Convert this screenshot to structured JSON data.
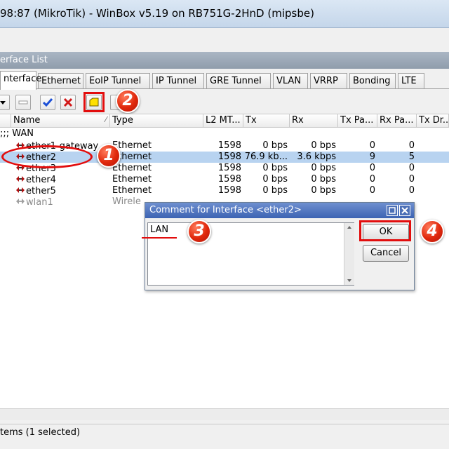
{
  "window": {
    "title": "98:87 (MikroTik) - WinBox v5.19 on RB751G-2HnD (mipsbe)"
  },
  "panel": {
    "header": "erface List"
  },
  "tabs": [
    {
      "label": "nterface",
      "active": true
    },
    {
      "label": "Ethernet"
    },
    {
      "label": "EoIP Tunnel"
    },
    {
      "label": "IP Tunnel"
    },
    {
      "label": "GRE Tunnel"
    },
    {
      "label": "VLAN"
    },
    {
      "label": "VRRP"
    },
    {
      "label": "Bonding"
    },
    {
      "label": "LTE"
    }
  ],
  "toolbar": {
    "buttons": [
      "dropdown-arrow",
      "disable",
      "enable",
      "remove",
      "comment",
      "filter"
    ],
    "colors": {
      "enable": "#1b4fd6",
      "remove": "#d21a1a",
      "comment": "#ffe000"
    }
  },
  "table": {
    "columns": [
      "Name",
      "Type",
      "L2 MT...",
      "Tx",
      "Rx",
      "Tx Pa...",
      "Rx Pa...",
      "Tx Dr..."
    ],
    "group": ";;; WAN",
    "rows": [
      {
        "name": "ether1-gateway",
        "type": "Ethernet",
        "mtu": "1598",
        "tx": "0 bps",
        "rx": "0 bps",
        "txp": "0",
        "rxp": "0"
      },
      {
        "name": "ether2",
        "type": "Ethernet",
        "mtu": "1598",
        "tx": "76.9 kb...",
        "rx": "3.6 kbps",
        "txp": "9",
        "rxp": "5",
        "selected": true
      },
      {
        "name": "ether3",
        "type": "Ethernet",
        "mtu": "1598",
        "tx": "0 bps",
        "rx": "0 bps",
        "txp": "0",
        "rxp": "0"
      },
      {
        "name": "ether4",
        "type": "Ethernet",
        "mtu": "1598",
        "tx": "0 bps",
        "rx": "0 bps",
        "txp": "0",
        "rxp": "0"
      },
      {
        "name": "ether5",
        "type": "Ethernet",
        "mtu": "1598",
        "tx": "0 bps",
        "rx": "0 bps",
        "txp": "0",
        "rxp": "0"
      },
      {
        "name": "wlan1",
        "type": "Wirele",
        "disabled": true
      }
    ]
  },
  "dialog": {
    "title": "Comment for Interface <ether2>",
    "comment_value": "LAN",
    "ok_label": "OK",
    "cancel_label": "Cancel"
  },
  "annotations": {
    "step1": "1",
    "step2": "2",
    "step3": "3",
    "step4": "4",
    "color": "#e20d0d"
  },
  "status": {
    "text": "tems (1 selected)"
  }
}
